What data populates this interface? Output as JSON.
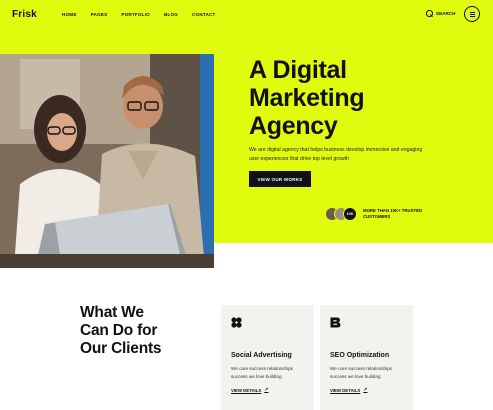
{
  "brand": {
    "logo": "Frisk",
    "accent": "#e1fb0f",
    "dark": "#111111"
  },
  "nav": {
    "items": [
      {
        "label": "HOME"
      },
      {
        "label": "PAGES"
      },
      {
        "label": "PORTFOLIO"
      },
      {
        "label": "BLOG"
      },
      {
        "label": "CONTACT"
      }
    ],
    "search_label": "SEARCH",
    "icons": {
      "search": "search-icon",
      "menu": "hamburger-menu-icon"
    }
  },
  "hero": {
    "headline": [
      "A Digital",
      "Marketing",
      "Agency"
    ],
    "description": "We are digital agency that helps business develop immersive and engaging user experiences that drive top level growth",
    "cta_label": "VIEW OUR WORKS",
    "trust_badge": "10K",
    "trust_text": "MORE THAN 10K+ TRUSTED CUSTOMERS"
  },
  "services": {
    "title": [
      "What We",
      "Can Do for",
      "Our Clients"
    ],
    "cards": [
      {
        "icon": "clover-icon",
        "title": "Social Advertising",
        "description": "We care success relationships success we love building",
        "link_label": "VIEW DETAILS",
        "link_arrow": "↗"
      },
      {
        "icon": "b-letter-icon",
        "title": "SEO Optimization",
        "description": "We care success relationships success we love building",
        "link_label": "VIEW DETAILS",
        "link_arrow": "↗"
      }
    ]
  }
}
